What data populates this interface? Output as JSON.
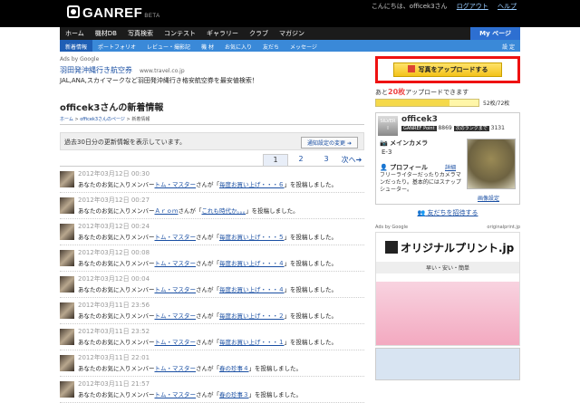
{
  "header": {
    "logo": "GANREF",
    "beta": "BETA",
    "greeting": "こんにちは、officek3さん",
    "logout": "ログアウト",
    "help": "ヘルプ"
  },
  "nav": {
    "items": [
      "ホーム",
      "機材DB",
      "写真検索",
      "コンテスト",
      "ギャラリー",
      "クラブ",
      "マガジン"
    ],
    "mypage": "My ページ"
  },
  "subnav": {
    "items": [
      "新着情報",
      "ポートフォリオ",
      "レビュー・撮影記",
      "機 材",
      "お気に入り",
      "友だち",
      "メッセージ"
    ],
    "settings": "設 定"
  },
  "ad": {
    "label": "Ads by Google",
    "title": "羽田発沖縄行き航空券",
    "url": "www.travel.co.jp",
    "text": "JAL,ANA,スカイマークなど羽田発沖縄行き格安航空券を最安値検索！"
  },
  "page": {
    "title": "officek3さんの新着情報",
    "crumbs_home": "ホーム",
    "crumbs_mypage": "officek3さんのページ",
    "crumbs_current": "新着情報",
    "description": "過去30日分の更新情報を表示しています。",
    "notify_button": "通知設定の変更",
    "pages": [
      "1",
      "2",
      "3"
    ],
    "next": "次へ"
  },
  "activity": [
    {
      "date": "2012年03月12日 00:30",
      "pre": "あなたのお気に入りメンバー",
      "user": "トム・マスター",
      "mid": "さんが「",
      "photo": "毎度お買い上げ・・・６",
      "post": "」を投稿しました。"
    },
    {
      "date": "2012年03月12日 00:27",
      "pre": "あなたのお気に入りメンバー",
      "user": "Ａｒｏｍ",
      "mid": "さんが「",
      "photo": "これも時代か。。。",
      "post": "」を投稿しました。"
    },
    {
      "date": "2012年03月12日 00:24",
      "pre": "あなたのお気に入りメンバー",
      "user": "トム・マスター",
      "mid": "さんが「",
      "photo": "毎度お買い上げ・・・５",
      "post": "」を投稿しました。"
    },
    {
      "date": "2012年03月12日 00:08",
      "pre": "あなたのお気に入りメンバー",
      "user": "トム・マスター",
      "mid": "さんが「",
      "photo": "毎度お買い上げ・・・４",
      "post": "」を投稿しました。"
    },
    {
      "date": "2012年03月12日 00:04",
      "pre": "あなたのお気に入りメンバー",
      "user": "トム・マスター",
      "mid": "さんが「",
      "photo": "毎度お買い上げ・・・４",
      "post": "」を投稿しました。"
    },
    {
      "date": "2012年03月11日 23:56",
      "pre": "あなたのお気に入りメンバー",
      "user": "トム・マスター",
      "mid": "さんが「",
      "photo": "毎度お買い上げ・・・２",
      "post": "」を投稿しました。"
    },
    {
      "date": "2012年03月11日 23:52",
      "pre": "あなたのお気に入りメンバー",
      "user": "トム・マスター",
      "mid": "さんが「",
      "photo": "毎度お買い上げ・・・１",
      "post": "」を投稿しました。"
    },
    {
      "date": "2012年03月11日 22:01",
      "pre": "あなたのお気に入りメンバー",
      "user": "トム・マスター",
      "mid": "さんが「",
      "photo": "春の珍事４",
      "post": "」を投稿しました。"
    },
    {
      "date": "2012年03月11日 21:57",
      "pre": "あなたのお気に入りメンバー",
      "user": "トム・マスター",
      "mid": "さんが「",
      "photo": "春の珍事３",
      "post": "」を投稿しました。"
    }
  ],
  "sidebar": {
    "upload_button": "写真をアップロードする",
    "remain_pre": "あと",
    "remain_num": "20枚",
    "remain_post": "アップロードできます",
    "quota_text": "52枚/72枚",
    "quota_fraction": 0.72,
    "rank": "SILVER",
    "username": "officek3",
    "points_label": "GANREF Point",
    "points": "8869",
    "next_rank_label": "次のランクまで",
    "next_rank": "3131",
    "camera_label": "メインカメラ",
    "camera": "E-3",
    "profile_label": "プロフィール",
    "profile_edit": "詳細",
    "profile_text": "フリーライターだったりカメラマンだったり。基本的にはスナップシューター。",
    "image_settings": "画像設定",
    "invite": "友だちを招待する"
  },
  "ad2": {
    "label": "Ads by Google",
    "url": "originalprint.jp",
    "brand": "オリジナルプリント.jp",
    "tagline": "早い・安い・簡単"
  }
}
